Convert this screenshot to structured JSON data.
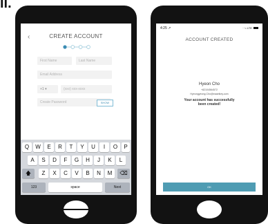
{
  "figure_label": "ii.",
  "create_account": {
    "back_icon": "chevron-left-icon",
    "title": "CREATE ACCOUNT",
    "fields": {
      "first_name_placeholder": "First Name",
      "last_name_placeholder": "Last Name",
      "email_placeholder": "Email Address",
      "country_code": "+1 ▾",
      "phone_placeholder": "(xxx) xxx-xxxx",
      "password_placeholder": "Create Password",
      "show_label": "SHOW"
    },
    "keyboard": {
      "row1": [
        "Q",
        "W",
        "E",
        "R",
        "T",
        "Y",
        "U",
        "I",
        "O",
        "P"
      ],
      "row2": [
        "A",
        "S",
        "D",
        "F",
        "G",
        "H",
        "J",
        "K",
        "L"
      ],
      "row3": [
        "Z",
        "X",
        "C",
        "V",
        "B",
        "N",
        "M"
      ],
      "shift_icon": "shift-icon",
      "backspace_icon": "backspace-icon",
      "numbers_label": "123",
      "space_label": "space",
      "next_label": "Next"
    }
  },
  "account_created": {
    "status_time": "4:25 ↗",
    "status_right": "LTE",
    "title": "ACCOUNT CREATED",
    "name": "Hyeon Cho",
    "phone": "+82104564572",
    "email": "Hyeongyeong.Cho@eaaeikey.com",
    "message_line1": "Your account has successfully",
    "message_line2": "been created!",
    "ok_label": "OK"
  }
}
